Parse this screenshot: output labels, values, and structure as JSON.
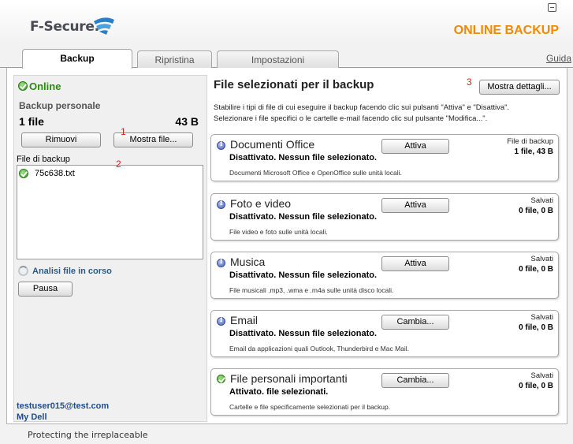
{
  "header": {
    "logo_text": "F-Secure.",
    "product_title": "ONLINE BACKUP"
  },
  "tabs": [
    {
      "label": "Backup",
      "active": true
    },
    {
      "label": "Ripristina",
      "active": false
    },
    {
      "label": "Impostazioni",
      "active": false
    }
  ],
  "guide_link": "Guida",
  "left": {
    "status": "Online",
    "backup_title": "Backup personale",
    "file_count": "1 file",
    "file_size": "43 B",
    "remove_button": "Rimuovi",
    "show_files_button": "Mostra file...",
    "file_list_label": "File di backup",
    "files": [
      {
        "name": "75c638.txt"
      }
    ],
    "analyzing_label": "Analisi file in corso",
    "pause_button": "Pausa",
    "user_email": "testuser015@test.com",
    "my_dell": "My Dell"
  },
  "markers": {
    "one": "1",
    "two": "2",
    "three": "3"
  },
  "right": {
    "title": "File selezionati per il backup",
    "details_button": "Mostra dettagli...",
    "description_line1": "Stabilire i tipi di file di cui eseguire il backup facendo clic sui pulsanti \"Attiva\" e \"Disattiva\".",
    "description_line2": "Selezionare i file specifici o le cartelle e-mail facendo clic sul pulsante \"Modifica...\"."
  },
  "categories": [
    {
      "title": "Documenti Office",
      "icon": "info-icon",
      "status": "Disattivato. Nessun file selezionato.",
      "description": "Documenti Microsoft Office e OpenOffice sulle unità locali.",
      "button": "Attiva",
      "label": "File di backup",
      "value": "1 file, 43 B"
    },
    {
      "title": "Foto e video",
      "icon": "info-icon",
      "status": "Disattivato. Nessun file selezionato.",
      "description": "File video e foto sulle unità locali.",
      "button": "Attiva",
      "label": "Salvati",
      "value": "0 file, 0 B"
    },
    {
      "title": "Musica",
      "icon": "info-icon",
      "status": "Disattivato. Nessun file selezionato.",
      "description": "File musicali .mp3, .wma e .m4a sulle unità disco locali.",
      "button": "Attiva",
      "label": "Salvati",
      "value": "0 file, 0 B"
    },
    {
      "title": "Email",
      "icon": "info-icon",
      "status": "Disattivato. Nessun file selezionato.",
      "description": "Email da applicazioni quali Outlook, Thunderbird e Mac Mail.",
      "button": "Cambia...",
      "label": "Salvati",
      "value": "0 file, 0 B"
    },
    {
      "title": "File personali importanti",
      "icon": "check-icon",
      "status": "Attivato. file selezionati.",
      "description": "Cartelle e file specificamente selezionati per il backup.",
      "button": "Cambia...",
      "label": "Salvati",
      "value": "0 file, 0 B"
    }
  ],
  "footer": {
    "tagline": "Protecting the irreplaceable"
  },
  "colors": {
    "brand_orange": "#f08a00",
    "online_green": "#2d8a14",
    "link_blue": "#1f4d8a"
  }
}
